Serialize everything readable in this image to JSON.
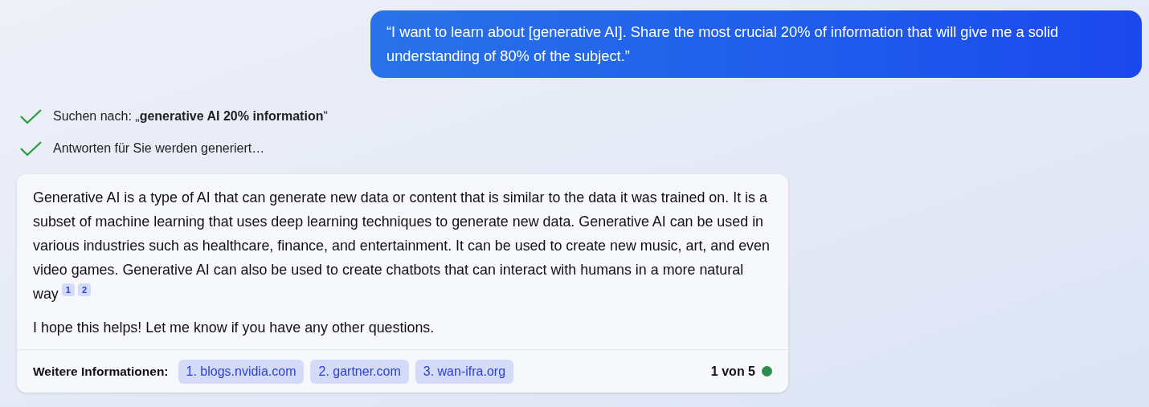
{
  "user_message": "“I want to learn about [generative AI]. Share the most crucial 20% of information that will give me a solid understanding of 80% of the subject.”",
  "status_steps": [
    {
      "text": "Suchen nach: „**generative AI 20% information**“",
      "done": true
    },
    {
      "text": "Antworten für Sie werden generiert…",
      "done": true
    }
  ],
  "answer": {
    "paragraphs": [
      {
        "text": "Generative AI is a type of AI that can generate new data or content that is similar to the data it was trained on. It is a subset of machine learning that uses deep learning techniques to generate new data. Generative AI can be used in various industries such as healthcare, finance, and entertainment. It can be used to create new music, art, and even video games. Generative AI can also be used to create chatbots that can interact with humans in a more natural way",
        "citations": [
          "1",
          "2"
        ]
      },
      {
        "text": "I hope this helps! Let me know if you have any other questions."
      }
    ]
  },
  "footer": {
    "label": "Weitere Informationen:",
    "sources": [
      "1. blogs.nvidia.com",
      "2. gartner.com",
      "3. wan-ifra.org"
    ],
    "counter": "1 von 5"
  }
}
